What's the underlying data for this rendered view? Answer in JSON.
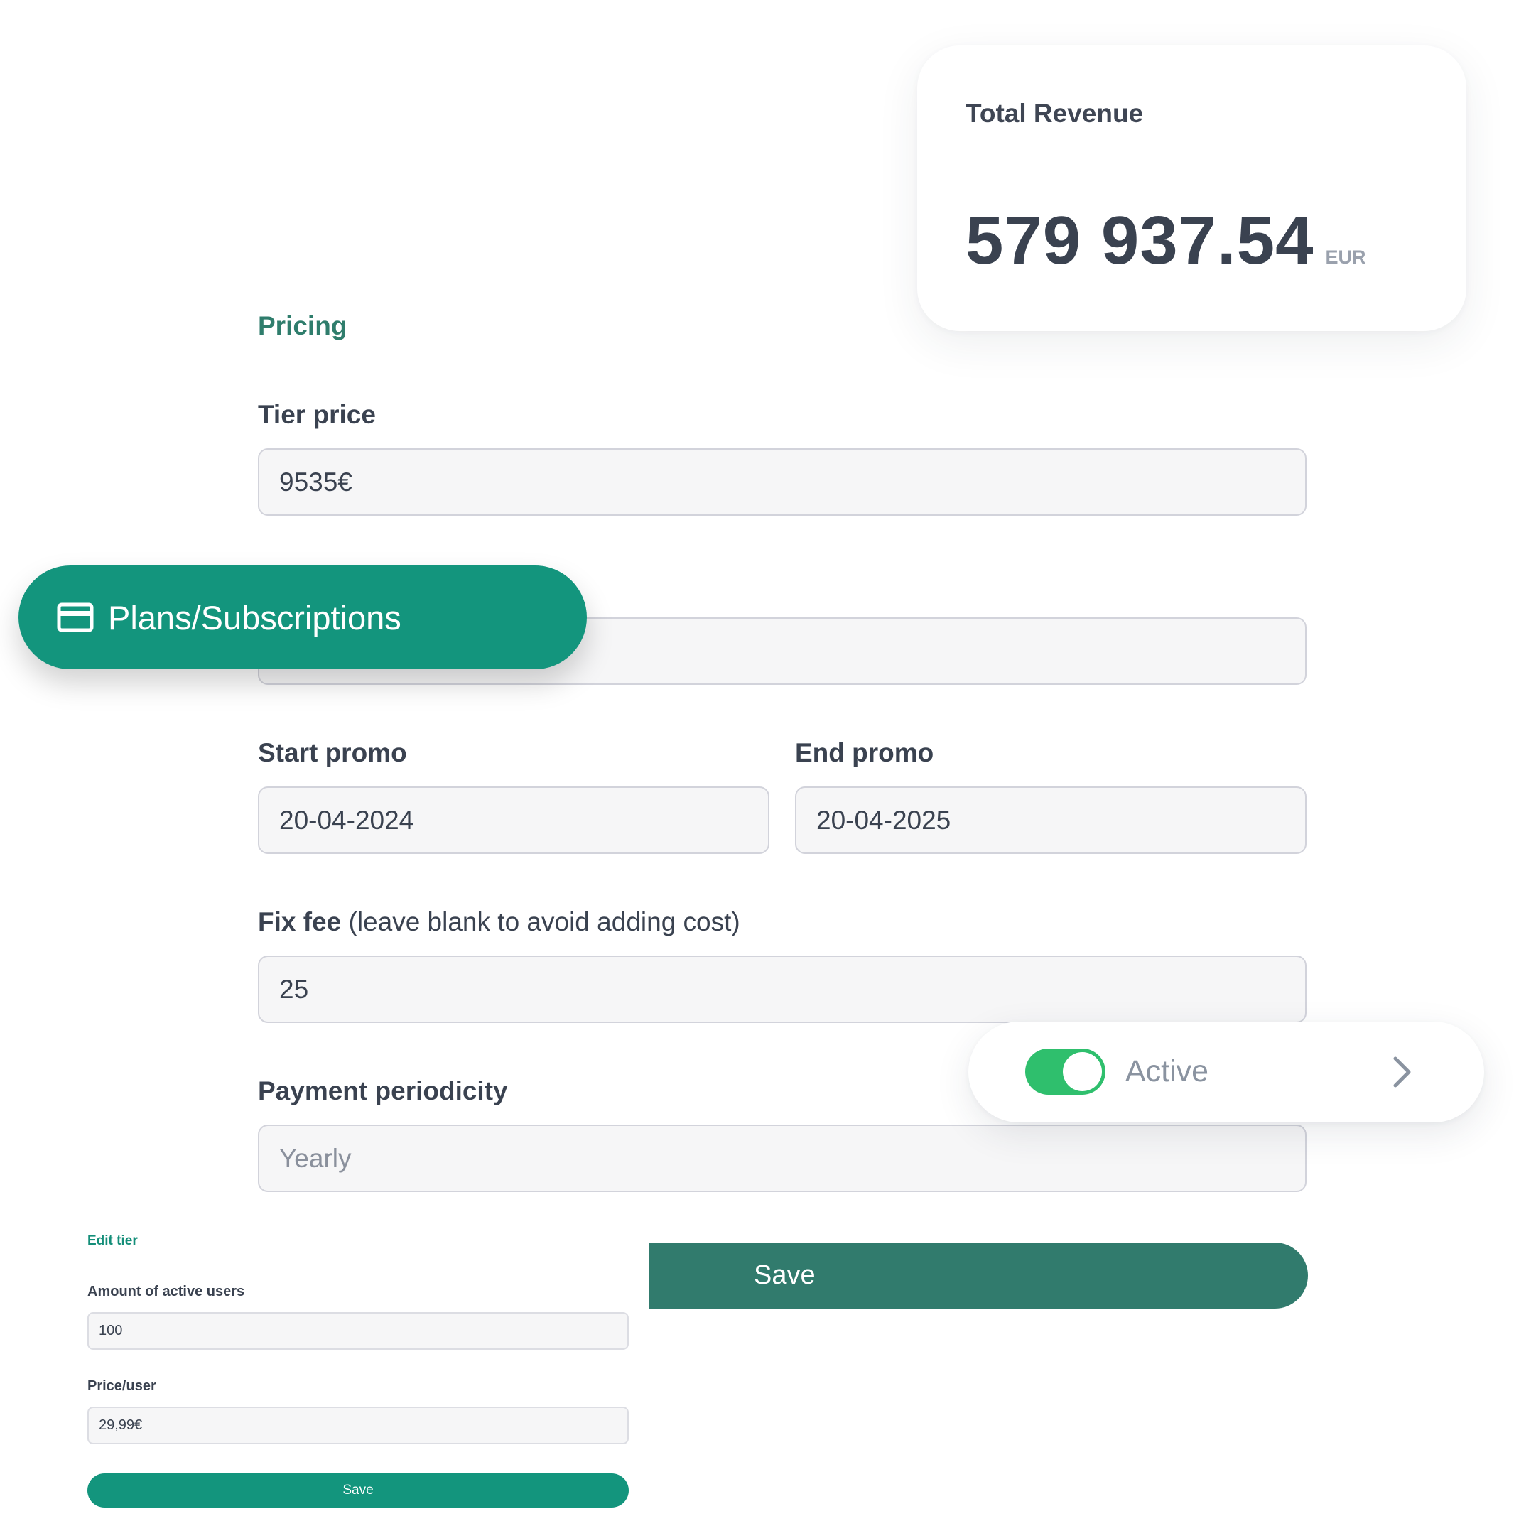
{
  "revenue": {
    "title": "Total Revenue",
    "amount": "579 937.54",
    "currency": "EUR"
  },
  "pricing": {
    "section_title": "Pricing",
    "tier_price_label": "Tier price",
    "tier_price_value": "9535€",
    "start_promo_label": "Start promo",
    "start_promo_value": "20-04-2024",
    "end_promo_label": "End promo",
    "end_promo_value": "20-04-2025",
    "fix_fee_label": "Fix fee",
    "fix_fee_hint": "(leave blank to avoid adding cost)",
    "fix_fee_value": "25",
    "periodicity_label": "Payment periodicity",
    "periodicity_value": "Yearly",
    "save_label": "Save"
  },
  "nav": {
    "label": "Plans/Subscriptions",
    "icon": "credit-card-icon"
  },
  "toggle": {
    "label": "Active",
    "on": true,
    "accent": "#2fbf6d",
    "icon": "chevron-right-icon"
  },
  "edit_tier": {
    "title": "Edit tier",
    "users_label": "Amount of active users",
    "users_value": "100",
    "price_label": "Price/user",
    "price_value": "29,99€",
    "save_label": "Save"
  },
  "colors": {
    "brand": "#13957d",
    "brand_dark": "#317b6d",
    "section": "#2f7d6c"
  }
}
